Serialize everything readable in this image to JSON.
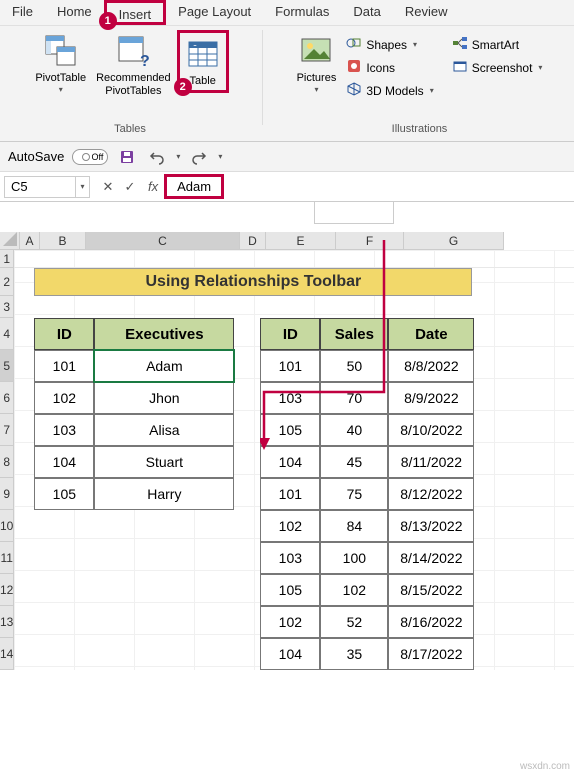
{
  "tabs": [
    "File",
    "Home",
    "Insert",
    "Page Layout",
    "Formulas",
    "Data",
    "Review"
  ],
  "activeTab": "Insert",
  "ribbon": {
    "tablesGroup": {
      "label": "Tables",
      "pivotTable": "PivotTable",
      "recommended": "Recommended\nPivotTables",
      "table": "Table"
    },
    "illustrationsGroup": {
      "label": "Illustrations",
      "pictures": "Pictures",
      "shapes": "Shapes",
      "icons": "Icons",
      "models": "3D Models",
      "smartart": "SmartArt",
      "screenshot": "Screenshot"
    }
  },
  "badge1": "1",
  "badge2": "2",
  "qat": {
    "autosaveLabel": "AutoSave",
    "autosaveState": "Off"
  },
  "nameBox": "C5",
  "formulaValue": "Adam",
  "columnHeaders": [
    "A",
    "B",
    "C",
    "D",
    "E",
    "F",
    "G"
  ],
  "rowHeaders": [
    "1",
    "2",
    "3",
    "4",
    "5",
    "6",
    "7",
    "8",
    "9",
    "10",
    "11",
    "12",
    "13",
    "14"
  ],
  "titleCell": "Using Relationships Toolbar",
  "table1": {
    "headers": [
      "ID",
      "Executives"
    ],
    "rows": [
      [
        "101",
        "Adam"
      ],
      [
        "102",
        "Jhon"
      ],
      [
        "103",
        "Alisa"
      ],
      [
        "104",
        "Stuart"
      ],
      [
        "105",
        "Harry"
      ]
    ]
  },
  "table2": {
    "headers": [
      "ID",
      "Sales",
      "Date"
    ],
    "rows": [
      [
        "101",
        "50",
        "8/8/2022"
      ],
      [
        "103",
        "70",
        "8/9/2022"
      ],
      [
        "105",
        "40",
        "8/10/2022"
      ],
      [
        "104",
        "45",
        "8/11/2022"
      ],
      [
        "101",
        "75",
        "8/12/2022"
      ],
      [
        "102",
        "84",
        "8/13/2022"
      ],
      [
        "103",
        "100",
        "8/14/2022"
      ],
      [
        "105",
        "102",
        "8/15/2022"
      ],
      [
        "102",
        "52",
        "8/16/2022"
      ],
      [
        "104",
        "35",
        "8/17/2022"
      ]
    ]
  },
  "watermark": "wsxdn.com"
}
